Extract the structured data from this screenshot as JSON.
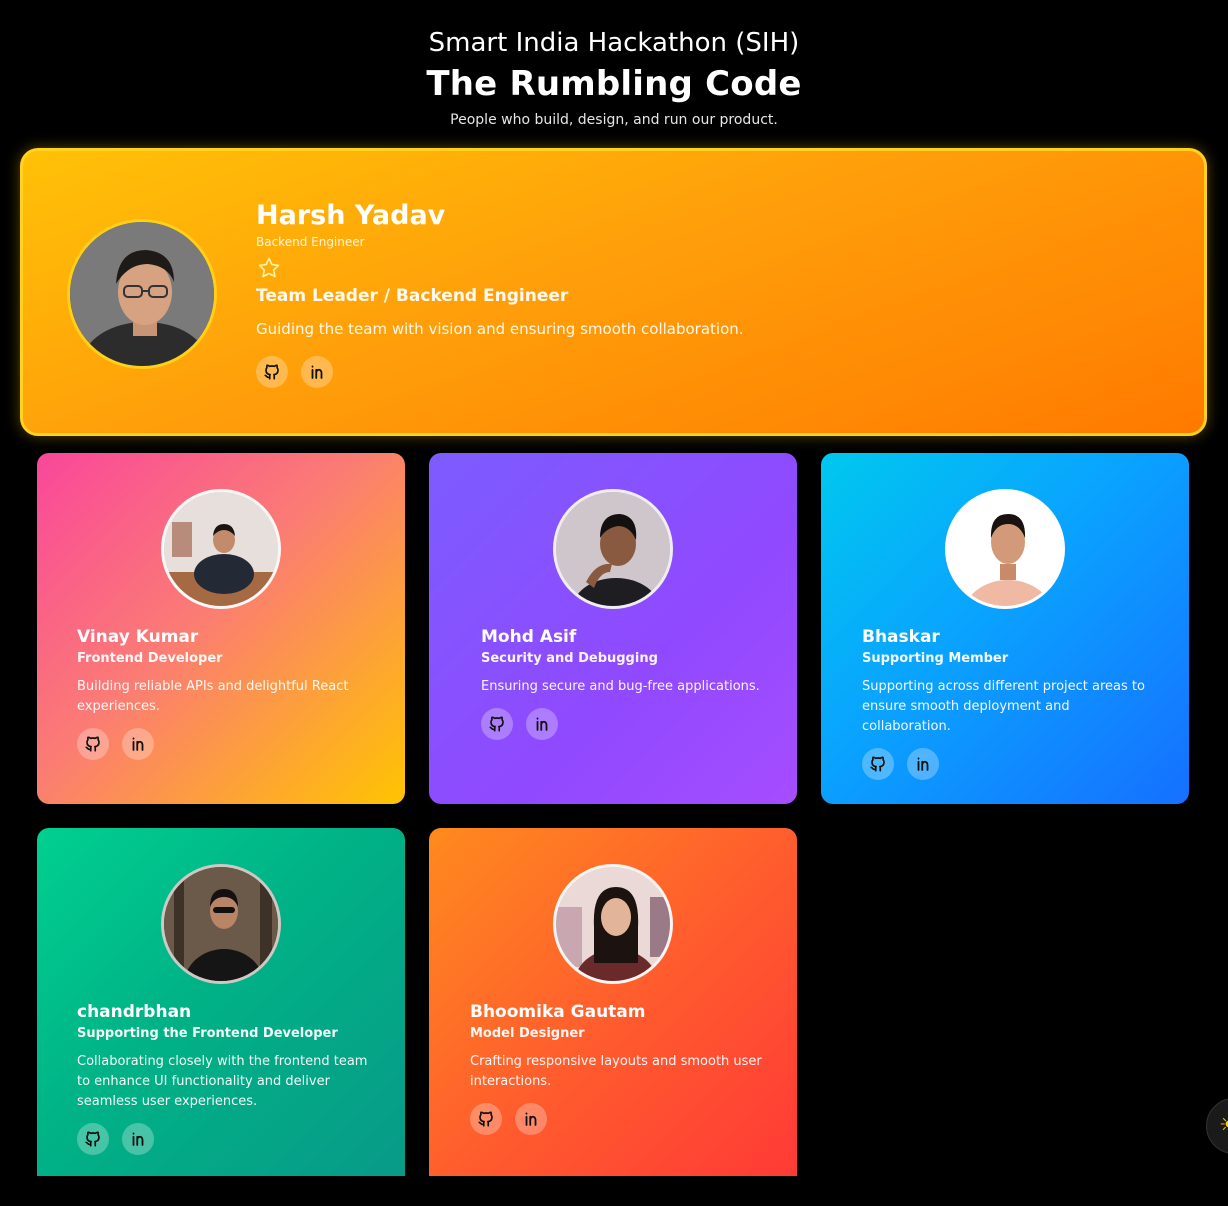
{
  "header": {
    "event": "Smart India Hackathon (SIH)",
    "team": "The Rumbling Code",
    "subtitle": "People who build, design, and run our product."
  },
  "leader": {
    "name": "Harsh Yadav",
    "role_small": "Backend Engineer",
    "badge_icon": "star-icon",
    "role": "Team Leader / Backend Engineer",
    "description": "Guiding the team with vision and ensuring smooth collaboration.",
    "socials": [
      "github-icon",
      "linkedin-icon"
    ]
  },
  "members": [
    {
      "name": "Vinay Kumar",
      "role": "Frontend Developer",
      "description": "Building reliable APIs and delightful React experiences.",
      "socials": [
        "github-icon",
        "linkedin-icon"
      ],
      "gradient": [
        "#f9479a",
        "#fb7c74",
        "#ffc400"
      ]
    },
    {
      "name": "Mohd Asif",
      "role": "Security and Debugging",
      "description": "Ensuring secure and bug-free applications.",
      "socials": [
        "github-icon",
        "linkedin-icon"
      ],
      "gradient": [
        "#7c5cff",
        "#9049ff",
        "#a64dff"
      ]
    },
    {
      "name": "Bhaskar",
      "role": "Supporting Member",
      "description": "Supporting across different project areas to ensure smooth deployment and collaboration.",
      "socials": [
        "github-icon",
        "linkedin-icon"
      ],
      "gradient": [
        "#00c8ee",
        "#0aa2ff",
        "#1670ff"
      ]
    },
    {
      "name": "chandrbhan",
      "role": "Supporting the Frontend Developer",
      "description": "Collaborating closely with the frontend team to enhance UI functionality and deliver seamless user experiences.",
      "socials": [
        "github-icon",
        "linkedin-icon"
      ],
      "gradient": [
        "#00d090",
        "#00b286",
        "#089a88"
      ]
    },
    {
      "name": "Bhoomika Gautam",
      "role": "Model Designer",
      "description": "Crafting responsive layouts and smooth user interactions.",
      "socials": [
        "github-icon",
        "linkedin-icon"
      ],
      "gradient": [
        "#ff8a1e",
        "#ff5a2e",
        "#ff3a36"
      ]
    }
  ],
  "colors": {
    "background": "#000000",
    "leader_border": "#ffd21f",
    "text": "#ffffff"
  }
}
